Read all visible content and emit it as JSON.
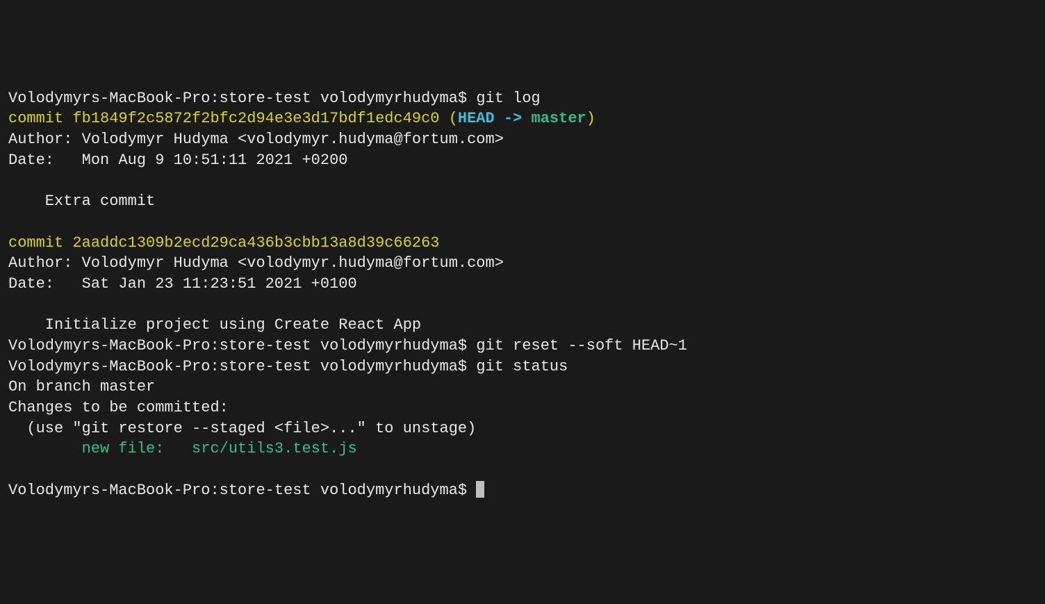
{
  "lines": {
    "l1_prompt": "Volodymyrs-MacBook-Pro:store-test volodymyrhudyma$ ",
    "l1_cmd": "git log",
    "l2_commit_label": "commit fb1849f2c5872f2bfc2d94e3e3d17bdf1edc49c0 (",
    "l2_head": "HEAD -> ",
    "l2_branch": "master",
    "l2_close": ")",
    "l3": "Author: Volodymyr Hudyma <volodymyr.hudyma@fortum.com>",
    "l4": "Date:   Mon Aug 9 10:51:11 2021 +0200",
    "l5": "",
    "l6": "    Extra commit",
    "l7": "",
    "l8": "commit 2aaddc1309b2ecd29ca436b3cbb13a8d39c66263",
    "l9": "Author: Volodymyr Hudyma <volodymyr.hudyma@fortum.com>",
    "l10": "Date:   Sat Jan 23 11:23:51 2021 +0100",
    "l11": "",
    "l12": "    Initialize project using Create React App",
    "l13_prompt": "Volodymyrs-MacBook-Pro:store-test volodymyrhudyma$ ",
    "l13_cmd": "git reset --soft HEAD~1",
    "l14_prompt": "Volodymyrs-MacBook-Pro:store-test volodymyrhudyma$ ",
    "l14_cmd": "git status",
    "l15": "On branch master",
    "l16": "Changes to be committed:",
    "l17": "  (use \"git restore --staged <file>...\" to unstage)",
    "l18_indent": "        ",
    "l18_file": "new file:   src/utils3.test.js",
    "l19": "",
    "l20_prompt": "Volodymyrs-MacBook-Pro:store-test volodymyrhudyma$ "
  }
}
